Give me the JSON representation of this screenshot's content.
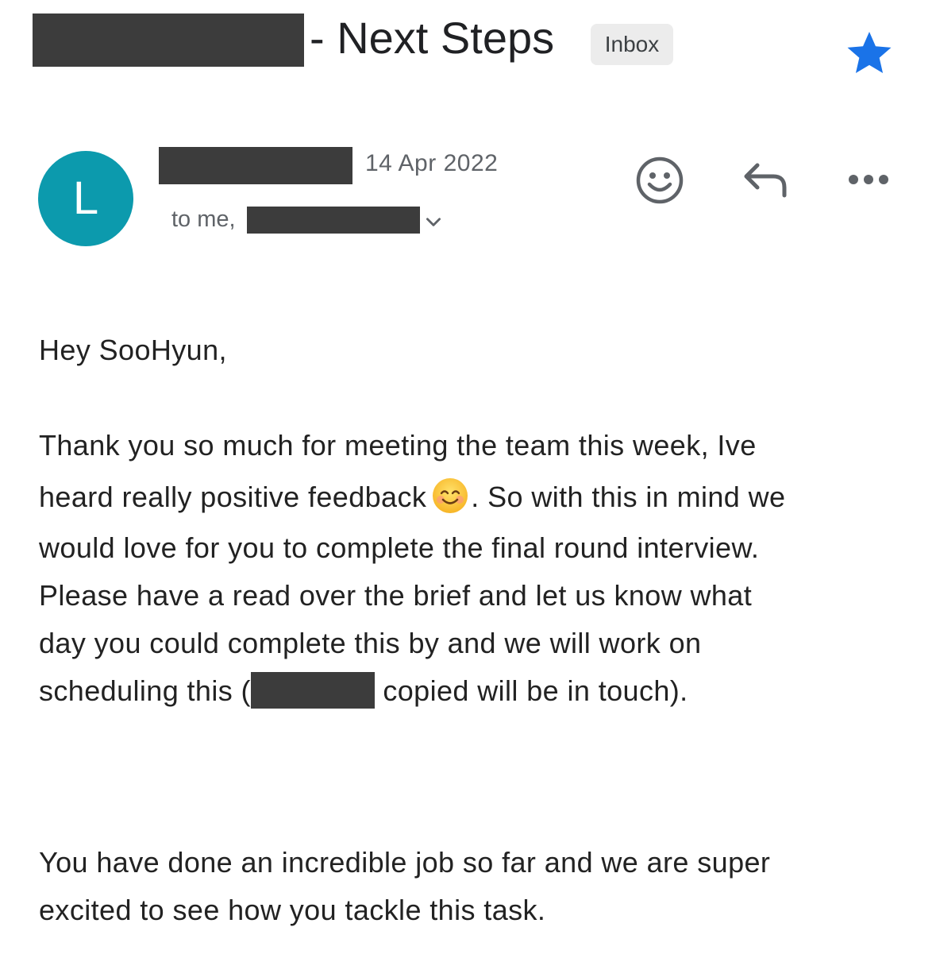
{
  "header": {
    "subject_suffix": "- Next Steps",
    "label_chip": "Inbox",
    "starred_color": "#1a73e8"
  },
  "message": {
    "avatar_letter": "L",
    "avatar_color": "#0c9aad",
    "date": "14 Apr 2022",
    "recipients_prefix": "to me,"
  },
  "actions": {
    "emoji_react_icon": "smiley-icon",
    "reply_icon": "reply-icon",
    "more_icon": "more-horizontal-icon"
  },
  "body": {
    "greeting": "Hey SooHyun,",
    "p1_line1": "Thank you so much for meeting the team this week, Ive",
    "p1_line2a": "heard really positive feedback",
    "p1_line2b": ". So with this in mind we",
    "p1_line3": "would love for you to complete the final round interview.",
    "p1_line4": "Please have a read over the brief and let us know what",
    "p1_line5": "day you could complete this by and we will work on",
    "p1_line6a": "scheduling this (",
    "p1_line6b": " copied will be in touch).",
    "p2_line1": "You have done an incredible job so far and we are super",
    "p2_line2": "excited to see how you tackle this task."
  }
}
